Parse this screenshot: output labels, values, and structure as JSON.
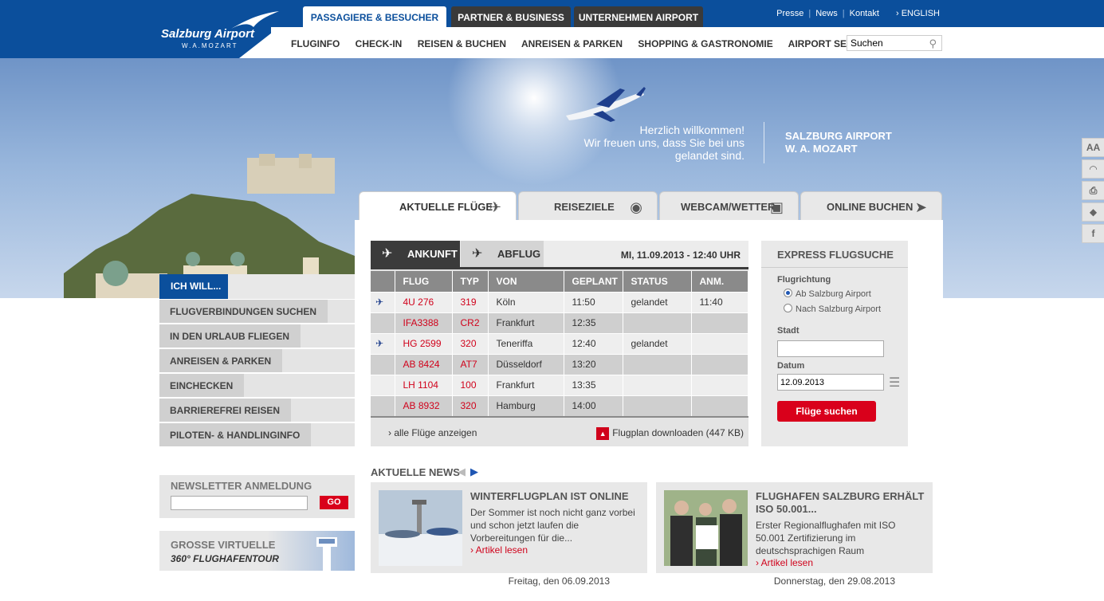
{
  "header": {
    "logo_name": "Salzburg Airport",
    "logo_sub": "W.A.MOZART",
    "top_tabs": [
      "PASSAGIERE & BESUCHER",
      "PARTNER & BUSINESS",
      "UNTERNEHMEN AIRPORT"
    ],
    "utility": [
      "Presse",
      "News",
      "Kontakt",
      "› ENGLISH"
    ],
    "nav": [
      "FLUGINFO",
      "CHECK-IN",
      "REISEN & BUCHEN",
      "ANREISEN & PARKEN",
      "SHOPPING & GASTRONOMIE",
      "AIRPORT SERVICES"
    ],
    "search_value": "Suchen"
  },
  "hero": {
    "welcome_line1": "Herzlich willkommen!",
    "welcome_line2": "Wir freuen uns, dass Sie bei uns",
    "welcome_line3": "gelandet sind.",
    "brand_line1": "SALZBURG AIRPORT",
    "brand_line2": "W. A. MOZART",
    "side_icons": [
      "AA",
      "rss",
      "print",
      "tag",
      "f"
    ]
  },
  "content_tabs": [
    "AKTUELLE FLÜGE",
    "REISEZIELE",
    "WEBCAM/WETTER",
    "ONLINE BUCHEN"
  ],
  "flights": {
    "tab_arrival": "ANKUNFT",
    "tab_departure": "ABFLUG",
    "date": "MI, 11.09.2013 - 12:40 UHR",
    "columns": [
      "FLUG",
      "TYP",
      "VON",
      "GEPLANT",
      "STATUS",
      "ANM."
    ],
    "rows": [
      {
        "landed": true,
        "flight": "4U 276",
        "type": "319",
        "from": "Köln",
        "planned": "11:50",
        "status": "gelandet",
        "note": "11:40"
      },
      {
        "landed": false,
        "flight": "IFA3388",
        "type": "CR2",
        "from": "Frankfurt",
        "planned": "12:35",
        "status": "",
        "note": ""
      },
      {
        "landed": true,
        "flight": "HG 2599",
        "type": "320",
        "from": "Teneriffa",
        "planned": "12:40",
        "status": "gelandet",
        "note": ""
      },
      {
        "landed": false,
        "flight": "AB 8424",
        "type": "AT7",
        "from": "Düsseldorf",
        "planned": "13:20",
        "status": "",
        "note": ""
      },
      {
        "landed": false,
        "flight": "LH 1104",
        "type": "100",
        "from": "Frankfurt",
        "planned": "13:35",
        "status": "",
        "note": ""
      },
      {
        "landed": false,
        "flight": "AB 8932",
        "type": "320",
        "from": "Hamburg",
        "planned": "14:00",
        "status": "",
        "note": ""
      }
    ],
    "all_flights": "› alle Flüge anzeigen",
    "download": "Flugplan downloaden (447 KB)"
  },
  "express": {
    "title": "EXPRESS FLUGSUCHE",
    "direction_label": "Flugrichtung",
    "option_from": "Ab Salzburg Airport",
    "option_to": "Nach Salzburg Airport",
    "city_label": "Stadt",
    "city_value": "",
    "date_label": "Datum",
    "date_value": "12.09.2013",
    "button": "Flüge suchen"
  },
  "leftnav": {
    "header": "ICH WILL...",
    "items": [
      "FLUGVERBINDUNGEN SUCHEN",
      "IN DEN URLAUB FLIEGEN",
      "ANREISEN & PARKEN",
      "EINCHECKEN",
      "BARRIEREFREI REISEN",
      "PILOTEN- & HANDLINGINFO"
    ]
  },
  "newsletter": {
    "title": "NEWSLETTER ANMELDUNG",
    "button": "GO"
  },
  "tour": {
    "line1": "GROSSE VIRTUELLE",
    "line2": "360° FLUGHAFENTOUR"
  },
  "news": {
    "header": "AKTUELLE NEWS",
    "items": [
      {
        "title": "WINTERFLUGPLAN IST ONLINE",
        "text": "Der Sommer ist noch nicht ganz vorbei und schon jetzt laufen die Vorbereitungen für die...",
        "more": "› Artikel lesen",
        "date": "Freitag, den 06.09.2013"
      },
      {
        "title": "FLUGHAFEN SALZBURG ERHÄLT ISO 50.001...",
        "text": "Erster Regionalflughafen mit ISO 50.001 Zertifizierung im deutschsprachigen Raum",
        "more": "› Artikel lesen",
        "date": "Donnerstag, den 29.08.2013"
      }
    ]
  }
}
